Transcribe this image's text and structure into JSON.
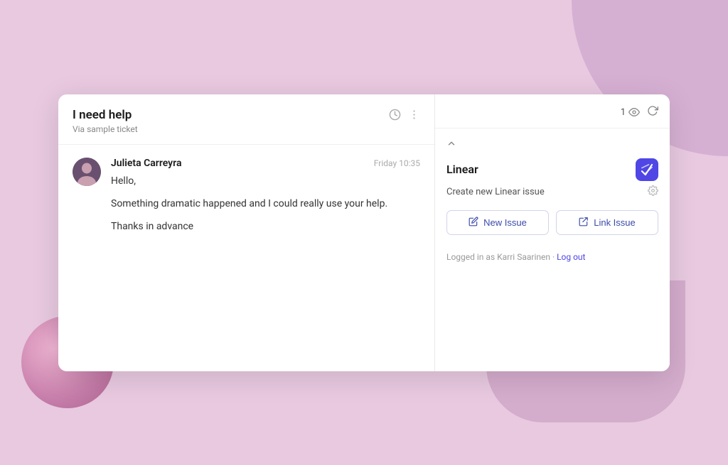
{
  "background": {
    "sphere_present": true
  },
  "ticket": {
    "title": "I need help",
    "subtitle": "Via sample ticket"
  },
  "message": {
    "sender": "Julieta Carreyra",
    "time": "Friday 10:35",
    "lines": [
      "Hello,",
      "Something dramatic happened and I could really use your help.",
      "Thanks in advance"
    ]
  },
  "right_panel": {
    "view_count": "1",
    "linear_title": "Linear",
    "create_label": "Create new Linear issue",
    "new_issue_label": "New Issue",
    "link_issue_label": "Link Issue",
    "logged_in_text": "Logged in as Karri Saarinen · ",
    "logout_label": "Log out"
  },
  "icons": {
    "history": "⏱",
    "more": "⋯",
    "collapse": "⌃",
    "eye": "👁",
    "refresh": "↻",
    "gear": "⚙",
    "new_issue_icon": "✎",
    "link_issue_icon": "🔗"
  }
}
